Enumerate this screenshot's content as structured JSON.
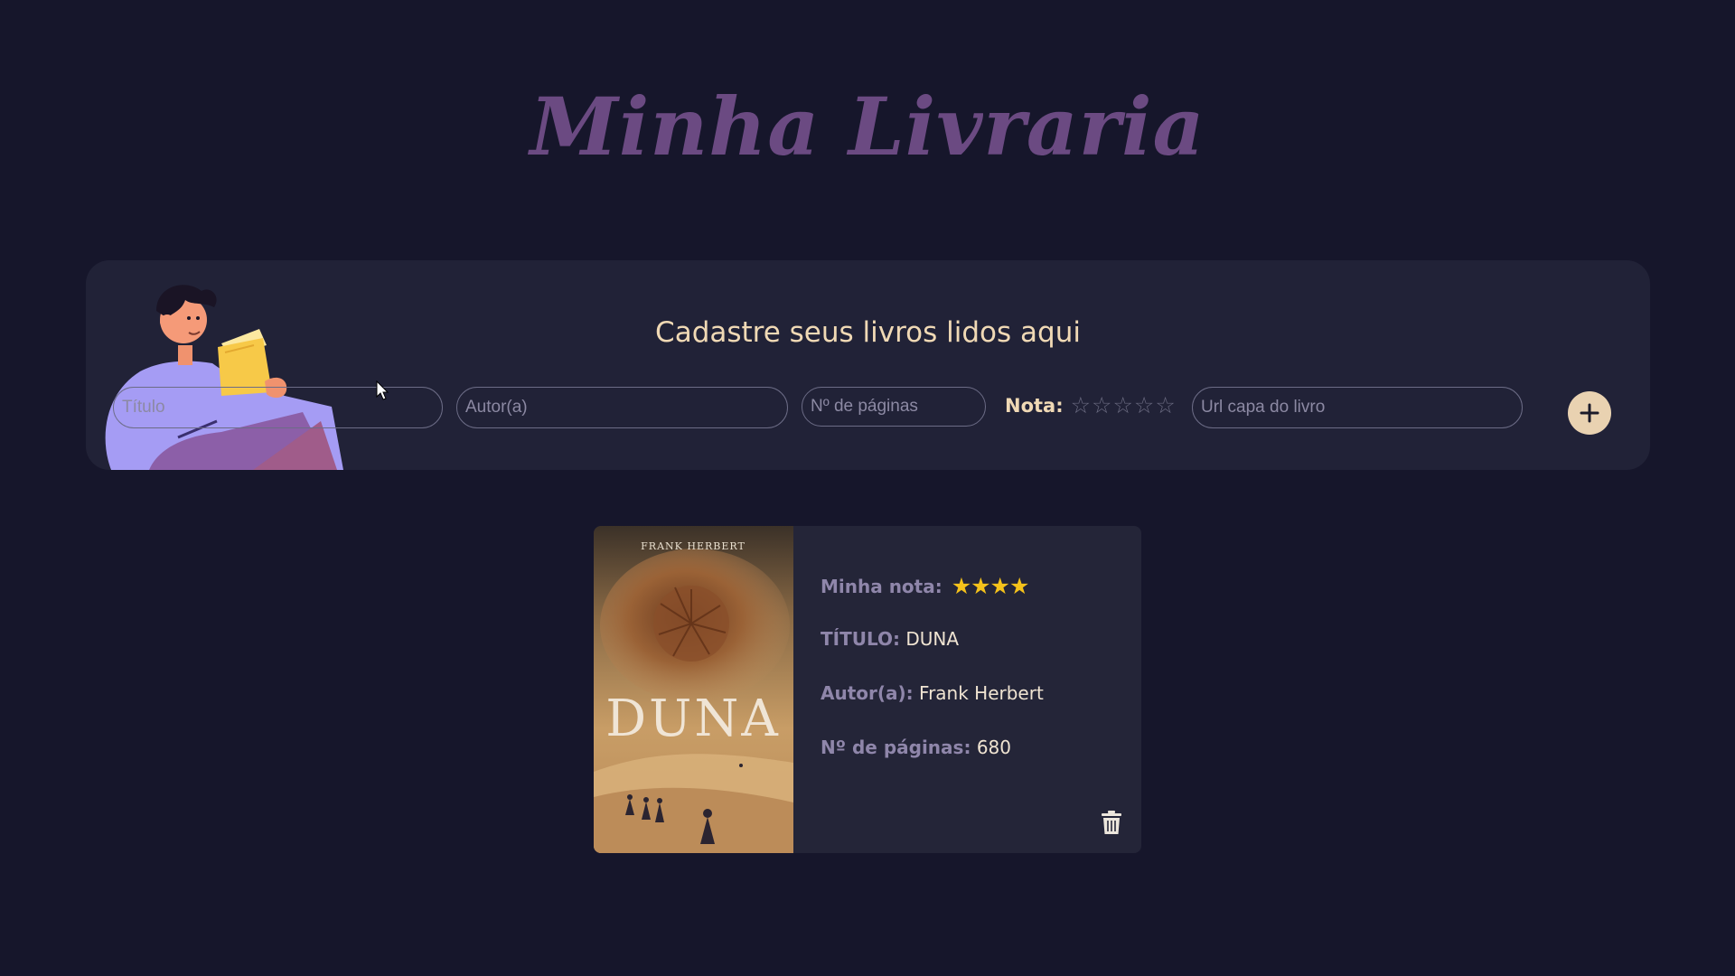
{
  "app": {
    "title": "Minha Livraria"
  },
  "form": {
    "heading": "Cadastre seus livros lidos aqui",
    "title_placeholder": "Título",
    "author_placeholder": "Autor(a)",
    "pages_placeholder": "Nº de páginas",
    "rating_label": "Nota:",
    "rating_stars": [
      "☆",
      "☆",
      "☆",
      "☆",
      "☆"
    ],
    "cover_url_placeholder": "Url capa do livro",
    "add_icon": "plus-icon"
  },
  "book": {
    "cover_author": "FRANK HERBERT",
    "cover_title": "DUNA",
    "rating_label": "Minha nota:",
    "rating_stars": "★★★★",
    "rating_value": 4,
    "title_label": "TÍTULO:",
    "title": "DUNA",
    "author_label": "Autor(a):",
    "author": "Frank Herbert",
    "pages_label": "Nº de páginas:",
    "pages": "680",
    "delete_icon": "trash-icon"
  },
  "colors": {
    "background": "#16162b",
    "panel": "#212237",
    "title": "#6b4a82",
    "accent_text": "#f0d9b5",
    "add_button": "#e9d2b1",
    "star_filled": "#f5c21b",
    "label": "#8f86aa"
  }
}
